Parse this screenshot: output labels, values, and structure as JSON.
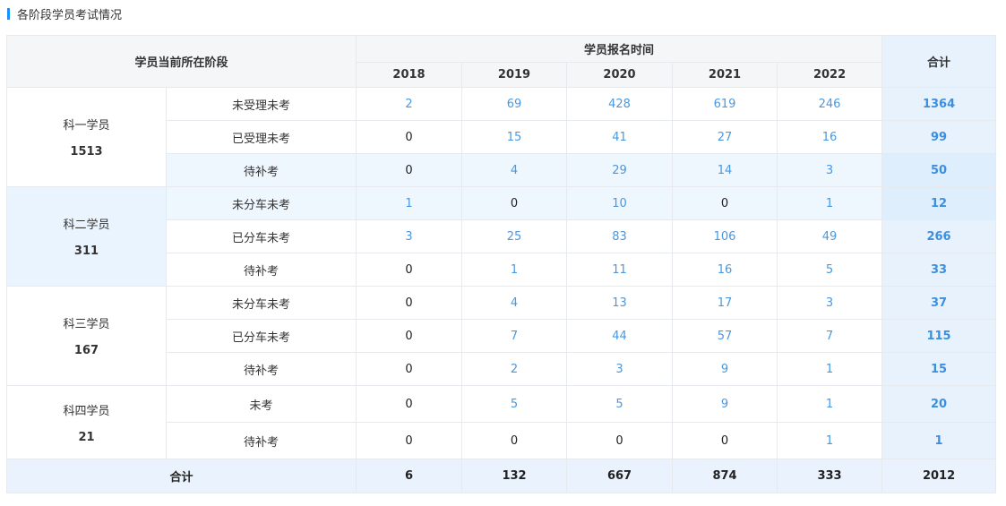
{
  "section": {
    "title": "各阶段学员考试情况"
  },
  "table": {
    "header_stage": "学员当前所在阶段",
    "header_time": "学员报名时间",
    "header_total": "合计",
    "years": [
      "2018",
      "2019",
      "2020",
      "2021",
      "2022"
    ],
    "groups": [
      {
        "name": "科一学员",
        "total": "1513",
        "rows": [
          {
            "label": "未受理未考",
            "values": [
              "2",
              "69",
              "428",
              "619",
              "246"
            ],
            "total": "1364"
          },
          {
            "label": "已受理未考",
            "values": [
              "0",
              "15",
              "41",
              "27",
              "16"
            ],
            "total": "99"
          },
          {
            "label": "待补考",
            "values": [
              "0",
              "4",
              "29",
              "14",
              "3"
            ],
            "total": "50"
          }
        ]
      },
      {
        "name": "科二学员",
        "total": "311",
        "rows": [
          {
            "label": "未分车未考",
            "values": [
              "1",
              "0",
              "10",
              "0",
              "1"
            ],
            "total": "12"
          },
          {
            "label": "已分车未考",
            "values": [
              "3",
              "25",
              "83",
              "106",
              "49"
            ],
            "total": "266"
          },
          {
            "label": "待补考",
            "values": [
              "0",
              "1",
              "11",
              "16",
              "5"
            ],
            "total": "33"
          }
        ]
      },
      {
        "name": "科三学员",
        "total": "167",
        "rows": [
          {
            "label": "未分车未考",
            "values": [
              "0",
              "4",
              "13",
              "17",
              "3"
            ],
            "total": "37"
          },
          {
            "label": "已分车未考",
            "values": [
              "0",
              "7",
              "44",
              "57",
              "7"
            ],
            "total": "115"
          },
          {
            "label": "待补考",
            "values": [
              "0",
              "2",
              "3",
              "9",
              "1"
            ],
            "total": "15"
          }
        ]
      },
      {
        "name": "科四学员",
        "total": "21",
        "rows": [
          {
            "label": "未考",
            "values": [
              "0",
              "5",
              "5",
              "9",
              "1"
            ],
            "total": "20"
          },
          {
            "label": "待补考",
            "values": [
              "0",
              "0",
              "0",
              "0",
              "1"
            ],
            "total": "1"
          }
        ]
      }
    ],
    "summary": {
      "label": "合计",
      "values": [
        "6",
        "132",
        "667",
        "874",
        "333"
      ],
      "total": "2012"
    }
  }
}
